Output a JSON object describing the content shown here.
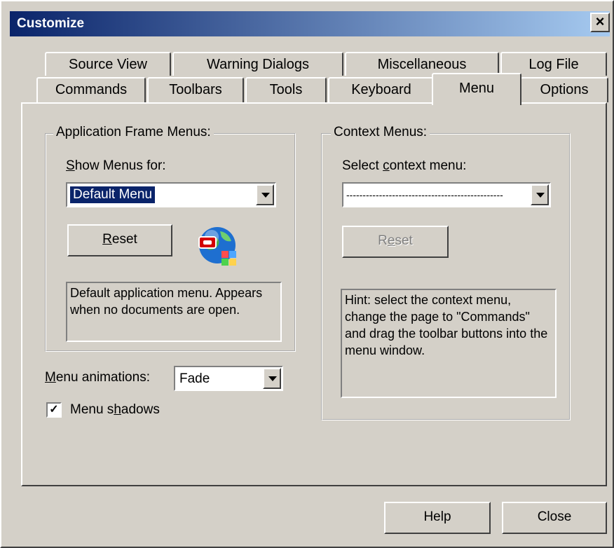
{
  "window": {
    "title": "Customize",
    "close_glyph": "×"
  },
  "tabs_back": [
    "Source View",
    "Warning Dialogs",
    "Miscellaneous",
    "Log File"
  ],
  "tabs_front": [
    "Commands",
    "Toolbars",
    "Tools",
    "Keyboard",
    "Menu",
    "Options"
  ],
  "active_tab": "Menu",
  "app_frame": {
    "legend": "Application Frame Menus:",
    "show_label_u": "S",
    "show_label_rest": "how Menus for:",
    "show_value": "Default Menu",
    "reset_u": "R",
    "reset_rest": "eset",
    "icon": "globe-menu-icon",
    "description": "Default application menu. Appears when no documents are open."
  },
  "context": {
    "legend": "Context Menus:",
    "select_label_pre": "Select ",
    "select_label_u": "c",
    "select_label_rest": "ontext menu:",
    "select_value": "------------------------------------------------",
    "reset_pre": "R",
    "reset_u": "e",
    "reset_rest": "set",
    "hint": "Hint: select the context menu, change the page to \"Commands\" and drag the toolbar buttons into the menu window."
  },
  "animations": {
    "label_u": "M",
    "label_rest": "enu animations:",
    "value": "Fade"
  },
  "shadows": {
    "label_pre": "Menu s",
    "label_u": "h",
    "label_rest": "adows",
    "checked": true,
    "check_glyph": "✓"
  },
  "footer": {
    "help": "Help",
    "close": "Close"
  }
}
